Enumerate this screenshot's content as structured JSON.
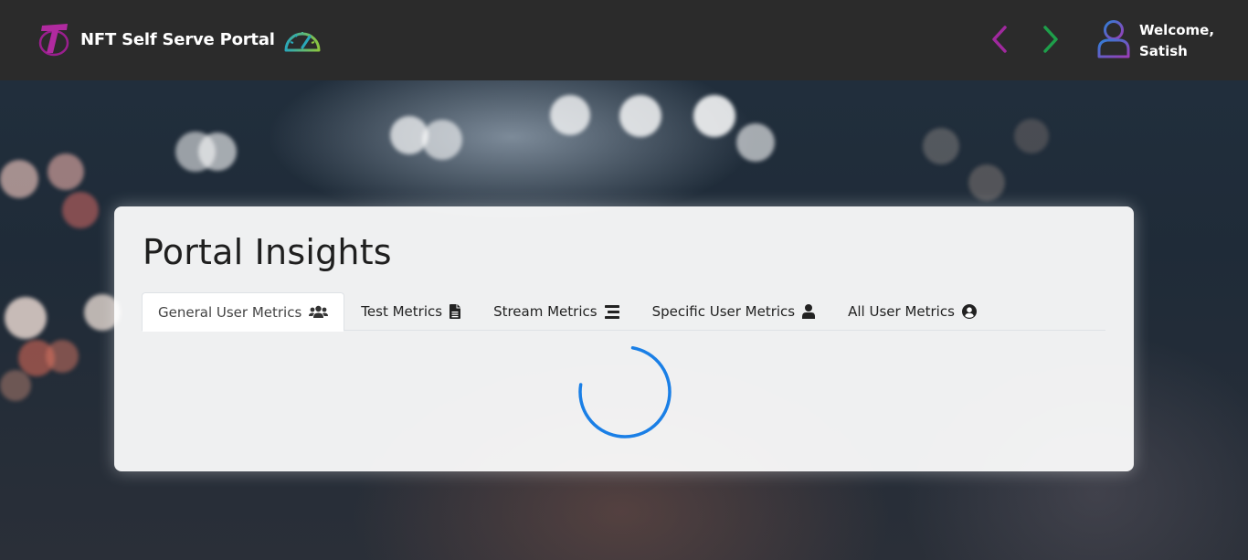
{
  "header": {
    "brand": "NFT Self Serve Portal",
    "welcome_line1": "Welcome,",
    "welcome_line2": "Satish",
    "logo_icon": "telstra-logo",
    "dashboard_icon": "speedometer-icon",
    "back_icon": "chevron-left-icon",
    "forward_icon": "chevron-right-icon",
    "user_icon": "user-outline-icon"
  },
  "card": {
    "title": "Portal Insights",
    "tabs": [
      {
        "label": "General User Metrics",
        "icon": "users-icon",
        "active": true
      },
      {
        "label": "Test Metrics",
        "icon": "document-icon",
        "active": false
      },
      {
        "label": "Stream Metrics",
        "icon": "stream-bars-icon",
        "active": false
      },
      {
        "label": "Specific User Metrics",
        "icon": "user-icon",
        "active": false
      },
      {
        "label": "All User Metrics",
        "icon": "user-circle-icon",
        "active": false
      }
    ],
    "loading": true
  },
  "colors": {
    "header_bg": "#2b2b2b",
    "back_arrow": "#a0299e",
    "forward_arrow": "#1e9e4a",
    "spinner": "#1a7fe6"
  }
}
